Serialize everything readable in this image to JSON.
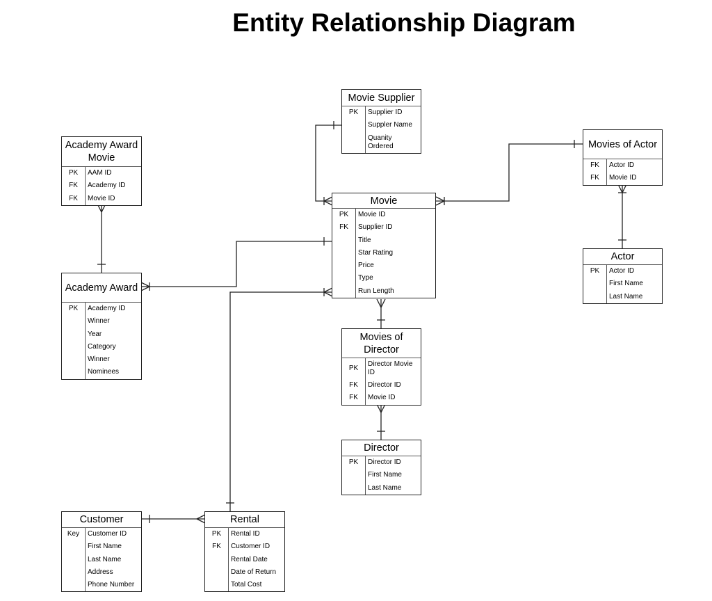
{
  "title": "Entity Relationship Diagram",
  "entities": {
    "academy_award_movie": {
      "name": "Academy Award Movie",
      "rows": [
        {
          "key": "PK",
          "attr": "AAM ID"
        },
        {
          "key": "FK",
          "attr": "Academy ID"
        },
        {
          "key": "FK",
          "attr": "Movie ID"
        }
      ]
    },
    "academy_award": {
      "name": "Academy Award",
      "rows": [
        {
          "key": "PK",
          "attr": "Academy ID"
        },
        {
          "key": "",
          "attr": "Winner"
        },
        {
          "key": "",
          "attr": "Year"
        },
        {
          "key": "",
          "attr": "Category"
        },
        {
          "key": "",
          "attr": "Winner"
        },
        {
          "key": "",
          "attr": "Nominees"
        }
      ]
    },
    "movie_supplier": {
      "name": "Movie Supplier",
      "rows": [
        {
          "key": "PK",
          "attr": "Supplier ID"
        },
        {
          "key": "",
          "attr": "Suppler Name"
        },
        {
          "key": "",
          "attr": "Quanity Ordered"
        }
      ]
    },
    "movie": {
      "name": "Movie",
      "rows": [
        {
          "key": "PK",
          "attr": "Movie ID"
        },
        {
          "key": "FK",
          "attr": "Supplier ID"
        },
        {
          "key": "",
          "attr": "Title"
        },
        {
          "key": "",
          "attr": "Star Rating"
        },
        {
          "key": "",
          "attr": "Price"
        },
        {
          "key": "",
          "attr": "Type"
        },
        {
          "key": "",
          "attr": "Run Length"
        }
      ]
    },
    "movies_of_actor": {
      "name": "Movies of Actor",
      "rows": [
        {
          "key": "FK",
          "attr": "Actor ID"
        },
        {
          "key": "FK",
          "attr": "Movie ID"
        }
      ]
    },
    "actor": {
      "name": "Actor",
      "rows": [
        {
          "key": "PK",
          "attr": "Actor ID"
        },
        {
          "key": "",
          "attr": "First Name"
        },
        {
          "key": "",
          "attr": "Last Name"
        }
      ]
    },
    "movies_of_director": {
      "name": "Movies of Director",
      "rows": [
        {
          "key": "PK",
          "attr": "Director Movie ID"
        },
        {
          "key": "FK",
          "attr": "Director ID"
        },
        {
          "key": "FK",
          "attr": "Movie ID"
        }
      ]
    },
    "director": {
      "name": "Director",
      "rows": [
        {
          "key": "PK",
          "attr": "Director ID"
        },
        {
          "key": "",
          "attr": "First Name"
        },
        {
          "key": "",
          "attr": "Last Name"
        }
      ]
    },
    "customer": {
      "name": "Customer",
      "rows": [
        {
          "key": "Key",
          "attr": "Customer ID"
        },
        {
          "key": "",
          "attr": "First Name"
        },
        {
          "key": "",
          "attr": "Last Name"
        },
        {
          "key": "",
          "attr": "Address"
        },
        {
          "key": "",
          "attr": "Phone Number"
        }
      ]
    },
    "rental": {
      "name": "Rental",
      "rows": [
        {
          "key": "PK",
          "attr": "Rental ID"
        },
        {
          "key": "FK",
          "attr": "Customer ID"
        },
        {
          "key": "",
          "attr": "Rental Date"
        },
        {
          "key": "",
          "attr": "Date of Return"
        },
        {
          "key": "",
          "attr": "Total Cost"
        }
      ]
    }
  },
  "relationships": [
    {
      "from": "Movie Supplier",
      "to": "Movie",
      "from_end": "one",
      "to_end": "many"
    },
    {
      "from": "Movies of Actor",
      "to": "Movie",
      "from_end": "one",
      "to_end": "many"
    },
    {
      "from": "Movies of Actor",
      "to": "Actor",
      "from_end": "many",
      "to_end": "one"
    },
    {
      "from": "Academy Award Movie",
      "to": "Academy Award",
      "from_end": "many",
      "to_end": "one"
    },
    {
      "from": "Academy Award",
      "to": "Movie",
      "from_end": "many",
      "to_end": "one"
    },
    {
      "from": "Rental",
      "to": "Movie",
      "from_end": "one",
      "to_end": "many"
    },
    {
      "from": "Movie",
      "to": "Movies of Director",
      "from_end": "many",
      "to_end": "one"
    },
    {
      "from": "Movies of Director",
      "to": "Director",
      "from_end": "many",
      "to_end": "one"
    },
    {
      "from": "Customer",
      "to": "Rental",
      "from_end": "one",
      "to_end": "many"
    }
  ]
}
